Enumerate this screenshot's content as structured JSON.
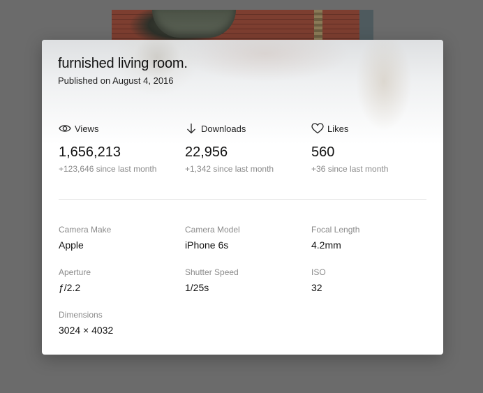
{
  "photo": {
    "title": "furnished living room.",
    "published": "Published on August 4, 2016"
  },
  "stats": [
    {
      "icon": "eye-icon",
      "label": "Views",
      "value": "1,656,213",
      "delta": "+123,646 since last month"
    },
    {
      "icon": "download-arrow-icon",
      "label": "Downloads",
      "value": "22,956",
      "delta": "+1,342 since last month"
    },
    {
      "icon": "heart-icon",
      "label": "Likes",
      "value": "560",
      "delta": "+36 since last month"
    }
  ],
  "exif": [
    {
      "label": "Camera Make",
      "value": "Apple"
    },
    {
      "label": "Camera Model",
      "value": "iPhone 6s"
    },
    {
      "label": "Focal Length",
      "value": "4.2mm"
    },
    {
      "label": "Aperture",
      "value": "ƒ/2.2"
    },
    {
      "label": "Shutter Speed",
      "value": "1/25s"
    },
    {
      "label": "ISO",
      "value": "32"
    },
    {
      "label": "Dimensions",
      "value": "3024 × 4032"
    }
  ],
  "colors": {
    "overlay": "#6b6b6b",
    "text": "#111111",
    "muted": "#8a8a8a",
    "divider": "#e5e5e5"
  }
}
